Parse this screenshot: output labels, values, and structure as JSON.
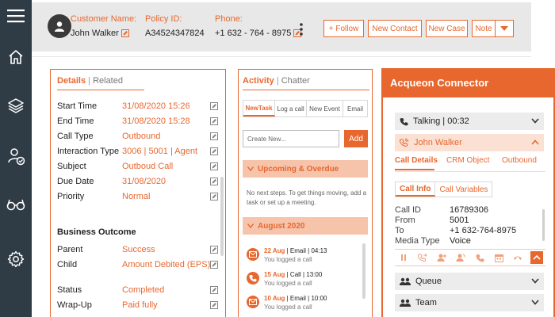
{
  "top_bar": {
    "customer": {
      "label": "Customer Name:",
      "value": "John Walker"
    },
    "policy": {
      "label": "Policy ID:",
      "value": "A34524347824"
    },
    "phone": {
      "label": "Phone:",
      "value": "+1 632 - 764 - 8975"
    },
    "buttons": {
      "follow": "+ Follow",
      "new_contact": "New Contact",
      "new_case": "New Case",
      "note": "Note"
    }
  },
  "left_nav": {
    "icons": [
      "menu-icon",
      "home-icon",
      "layers-icon",
      "user-check-icon",
      "glasses-icon",
      "settings-icon"
    ]
  },
  "details": {
    "tabs": {
      "active": "Details",
      "separator": "|",
      "inactive": "Related"
    },
    "rows": [
      {
        "label": "Start Time",
        "value": "31/08/2020 15:26"
      },
      {
        "label": "End Time",
        "value": "31/08/2020 15:28"
      },
      {
        "label": "Call Type",
        "value": "Outbound"
      },
      {
        "label": "Interaction Type",
        "value": "3006 | 5001 | Agent"
      },
      {
        "label": "Subject",
        "value": "Outboud Call"
      },
      {
        "label": "Due Date",
        "value": "31/08/2020"
      },
      {
        "label": "Priority",
        "value": "Normal"
      }
    ],
    "business_outcome": {
      "title": "Business Outcome",
      "rows": [
        {
          "label": "Parent",
          "value": "Success"
        },
        {
          "label": "Child",
          "value": "Amount Debited (EPS)"
        }
      ]
    },
    "status_rows": [
      {
        "label": "Status",
        "value": "Completed"
      },
      {
        "label": "Wrap-Up",
        "value": "Paid fully"
      }
    ]
  },
  "activity": {
    "tabs": {
      "active": "Activity",
      "separator": "|",
      "inactive": "Chatter"
    },
    "subtabs": [
      "NewTask",
      "Log a call",
      "New Event",
      "Email"
    ],
    "input_placeholder": "Create New...",
    "add_label": "Add",
    "upcoming_label": "Upcoming & Overdue",
    "empty_text": "No next steps. To get things moving, add a task or set up a meeting.",
    "month_label": "August 2020",
    "items": [
      {
        "date": "22 Aug",
        "type": "Email",
        "time": "04:13",
        "desc": "You logged a call"
      },
      {
        "date": "15 Aug",
        "type": "Call",
        "time": "13:00",
        "desc": "You logged a call"
      },
      {
        "date": "10 Aug",
        "type": "Email",
        "time": "10:00",
        "desc": "You logged a call"
      }
    ],
    "item_separator": "|"
  },
  "connector": {
    "title": "Acqueon Connector",
    "talking": "Talking | 00:32",
    "contact": "John Walker",
    "tabs": [
      "Call Details",
      "CRM Object",
      "Outbound"
    ],
    "info_tabs": [
      "Call Info",
      "Call Variables"
    ],
    "call_info": [
      {
        "key": "Call ID",
        "value": "16789306"
      },
      {
        "key": "From",
        "value": "5001"
      },
      {
        "key": "To",
        "value": "+1 632-764-8975"
      },
      {
        "key": "Media Type",
        "value": "Voice"
      }
    ],
    "queue": "Queue",
    "team": "Team"
  },
  "colors": {
    "accent": "#e8672e",
    "nav_bg": "#2f3b45",
    "header_bg": "#e8e8e8",
    "accordion_bg": "#f6c3ab"
  }
}
